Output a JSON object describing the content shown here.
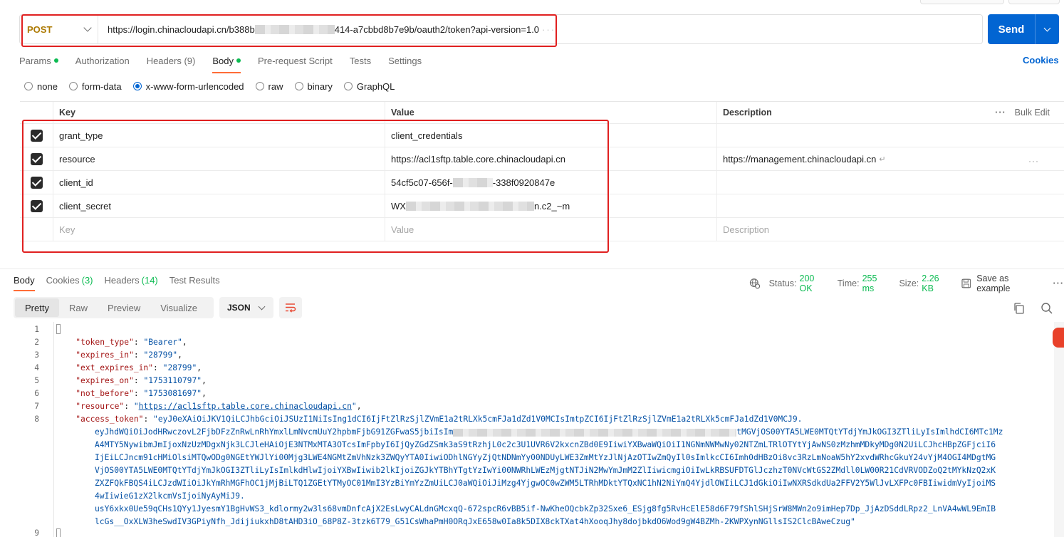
{
  "request": {
    "method": "POST",
    "url_prefix": "https://login.chinacloudapi.cn/b388b",
    "url_suffix": "414-a7cbbd8b7e9b/oauth2/token?api-version=1.0",
    "url_more": "···",
    "send_label": "Send"
  },
  "tabs": {
    "params": "Params",
    "authorization": "Authorization",
    "headers": "Headers",
    "headers_count": "(9)",
    "body": "Body",
    "prerequest": "Pre-request Script",
    "tests": "Tests",
    "settings": "Settings",
    "cookies": "Cookies"
  },
  "body_types": [
    "none",
    "form-data",
    "x-www-form-urlencoded",
    "raw",
    "binary",
    "GraphQL"
  ],
  "body_type_selected": "x-www-form-urlencoded",
  "table": {
    "headers": {
      "key": "Key",
      "value": "Value",
      "description": "Description",
      "bulk_edit": "Bulk Edit",
      "more": "···"
    },
    "rows": [
      {
        "key": "grant_type",
        "value": "client_credentials",
        "description": ""
      },
      {
        "key": "resource",
        "value": "https://acl1sftp.table.core.chinacloudapi.cn",
        "description": "https://management.chinacloudapi.cn"
      },
      {
        "key": "client_id",
        "value_prefix": "54cf5c07-656f-",
        "value_suffix": "-338f0920847e",
        "description": ""
      },
      {
        "key": "client_secret",
        "value_prefix": "WX",
        "value_suffix": "n.c2_~m",
        "description": ""
      }
    ],
    "placeholder": {
      "key": "Key",
      "value": "Value",
      "description": "Description"
    }
  },
  "response": {
    "tabs": {
      "body": "Body",
      "cookies": "Cookies",
      "cookies_count": "(3)",
      "headers": "Headers",
      "headers_count": "(14)",
      "test_results": "Test Results"
    },
    "status_label": "Status:",
    "status_value": "200 OK",
    "time_label": "Time:",
    "time_value": "255 ms",
    "size_label": "Size:",
    "size_value": "2.26 KB",
    "save_example": "Save as example",
    "more": "···",
    "views": [
      "Pretty",
      "Raw",
      "Preview",
      "Visualize"
    ],
    "view_selected": "Pretty",
    "format": "JSON"
  },
  "code": {
    "line_numbers": [
      "1",
      "2",
      "3",
      "4",
      "5",
      "6",
      "7",
      "8",
      "9"
    ],
    "fields": [
      {
        "key": "\"token_type\"",
        "value": "\"Bearer\""
      },
      {
        "key": "\"expires_in\"",
        "value": "\"28799\""
      },
      {
        "key": "\"ext_expires_in\"",
        "value": "\"28799\""
      },
      {
        "key": "\"expires_on\"",
        "value": "\"1753110797\""
      },
      {
        "key": "\"not_before\"",
        "value": "\"1753081697\""
      },
      {
        "key": "\"resource\"",
        "value": "https://acl1sftp.table.core.chinacloudapi.cn"
      },
      {
        "key": "\"access_token\"",
        "value": "\"eyJ0eXAiOiJKV1QiLCJhbGciOiJSUzI1NiIsIng1dCI6IjFtZlRzSjlZVmE1a2tRLXk5cmFJa1dZd1V0MCIsImtpZCI6IjFtZlRzSjlZVmE1a2tRLXk5cmFJa1dZd1V0MCJ9."
      }
    ],
    "token_lines": [
      "eyJhdWQiOiJodHRwczovL2FjbDFzZnRwLnRhYmxlLmNvcmUuY2hpbmFjbG91ZGFwaS5jbiIsIm",
      "A4MTY5NywibmJmIjoxNzUzMDgxNjk3LCJleHAiOjE3NTMxMTA3OTcsImFpbyI6IjQyZGdZSmk3aS9tRzhjL0c2c3U1UVR6V2kxcnZBd0E9IiwiYXBwaWQiOiI1NGNmNWMwNy02NTZmLTRlOTYtYjAwNS0zMzhmMDkyMDg0N2UiLCJhcHBpZGFjciI6",
      "IjEiLCJncm91cHMiOlsiMTQwODg0NGEtYWJlYi00Mjg3LWE4NGMtZmVhNzk3ZWQyYTA0IiwiODhlNGYyZjQtNDNmYy00NDUyLWE3ZmMtYzJlNjAzOTIwZmQyIl0sImlkcCI6Imh0dHBzOi8vc3RzLmNoaW5hY2xvdWRhcGkuY24vYjM4OGI4MDgtMG",
      "VjOS00YTA5LWE0MTQtYTdjYmJkOGI3ZTliLyIsImlkdHlwIjoiYXBwIiwib2lkIjoiZGJkYTBhYTgtYzIwYi00NWRhLWEzMjgtNTJiN2MwYmJmM2ZlIiwicmgiOiIwLkRBSUFDTGlJczhzT0NVcWtGS2ZMdll0LW00R21CdVRVODZoQ2tMYkNzQ2xK",
      "ZXZFQkFBQS4iLCJzdWIiOiJkYmRhMGFhOC1jMjBiLTQ1ZGEtYTMyOC01MmI3YzBiYmYzZmUiLCJ0aWQiOiJiMzg4YjgwOC0wZWM5LTRhMDktYTQxNC1hN2NiYmQ4YjdlOWIiLCJ1dGkiOiIwNXRSdkdUa2FFV2Y5WlJvLXFPc0FBIiwidmVyIjoiMS",
      "4wIiwieG1zX2lkcmVsIjoiNyAyMiJ9.",
      "usY6xkx0Ue59qCHs1QYy1JyesmY1BgHvWS3_kdlormy2w3ls68vmDnfcAjX2EsLwyCALdnGMcxqQ-672spcR6vBB5if-NwKheOQcbkZp32Sxe6_ESjg8fg5RvHcElE58d6F79fShlSHjSrW8MWn2o9imHep7Dp_JjAzDSddLRpz2_LnVA4wWL9EmIB",
      "lcGs__OxXLW3heSwdIV3GPiyNfh_JdijiukxhD8tAHD3iO_68P8Z-3tzk6T79_G51CsWhaPmH0ORqJxE658w0Ia8k5DIX8ckTXat4hXooqJhy8dojbkdO6Wod9gW4BZMh-2KWPXynNGllsIS2ClcBAweCzug\""
    ],
    "token_line1_tail": "tMGVjOS00YTA5LWE0MTQtYTdjYmJkOGI3ZTliLyIsImlhdCI6MTc1Mz"
  }
}
